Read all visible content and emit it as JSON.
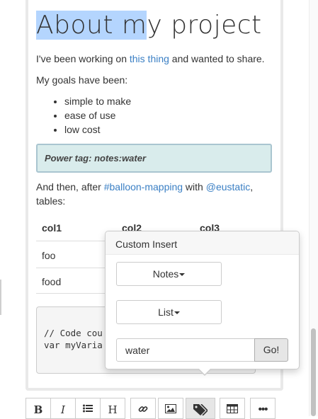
{
  "document": {
    "heading_selected": "About m",
    "heading_rest": "y project",
    "intro_before": "I've been working on ",
    "intro_link": "this thing",
    "intro_after": " and wanted to share.",
    "goals_label": "My goals have been:",
    "goals": [
      "simple to make",
      "ease of use",
      "low cost"
    ],
    "power_tag": "Power tag: notes:water",
    "after_before": "And then, after ",
    "after_tag": "#balloon-mapping",
    "after_mid": " with ",
    "after_user": "@eustatic",
    "after_end": ",",
    "tables_label": "tables:",
    "table": {
      "headers": [
        "col1",
        "col2",
        "col3"
      ],
      "rows": [
        [
          "foo",
          "",
          ""
        ],
        [
          "food",
          "",
          ""
        ]
      ]
    },
    "code_line_1": "// Code cou",
    "code_line_2": "var myVaria"
  },
  "popover": {
    "title": "Custom Insert",
    "notes_button": "Notes",
    "list_button": "List",
    "input_value": "water",
    "go_button": "Go!"
  },
  "toolbar": {
    "buttons": [
      {
        "label": "B",
        "icon": "bold-icon"
      },
      {
        "label": "I",
        "icon": "italic-icon"
      },
      {
        "label": "",
        "icon": "list-icon"
      },
      {
        "label": "H",
        "icon": "heading-icon"
      },
      {
        "label": "",
        "icon": "link-icon"
      },
      {
        "label": "",
        "icon": "image-icon"
      },
      {
        "label": "",
        "icon": "tags-icon"
      },
      {
        "label": "",
        "icon": "table-icon"
      },
      {
        "label": "•••",
        "icon": "more-icon"
      }
    ]
  },
  "colors": {
    "link": "#3a7fc4",
    "selection": "#b4d5fe",
    "power_tag_bg": "#d9ecec"
  }
}
